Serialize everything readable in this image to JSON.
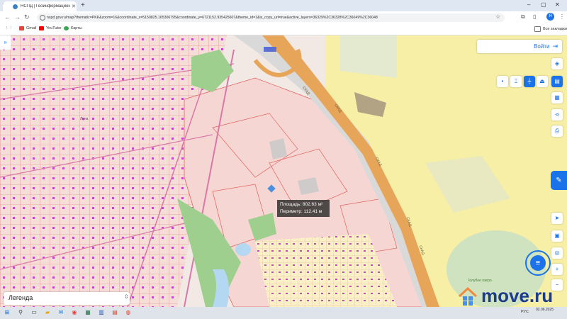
{
  "browser": {
    "tab_title": "НСПД | Геоинформационный",
    "url": "nspd.gov.ru/map?thematic=PKK&zoom=16&coordinate_x=5150825.165306795&coordinate_y=6721152.935425607&theme_id=1&is_copy_url=true&active_layers=36329%2C36328%2C36049%2C36048",
    "bookmarks": [
      {
        "label": "Gmail",
        "icon": "gmail-icon",
        "color": "#ea4335"
      },
      {
        "label": "YouTube",
        "icon": "youtube-icon",
        "color": "#ff0000"
      },
      {
        "label": "Карты",
        "icon": "maps-icon",
        "color": "#34a853"
      }
    ],
    "all_bookmarks": "Все закладки",
    "profile_initial": "Я"
  },
  "map": {
    "login_label": "Войти",
    "road_label_1": "СКАД",
    "road_label_2": "СКАД",
    "road_label_3": "СКАД",
    "road_label_4": "СКАД",
    "road_label_5": "СКАД",
    "area_label": "Голубое озеро",
    "place_label": "Луна",
    "measure": {
      "area": "Площадь: 802.63 м²",
      "perimeter": "Периметр: 112.41 м"
    },
    "legend_label": "Легенда",
    "colors": {
      "accent": "#1a73e8",
      "parcel_border": "#e0625f",
      "parcel_fill": "#f6d6d3",
      "road": "#e7a55a",
      "yellow_zone": "#f7efa6",
      "park": "#9ecf8e",
      "water": "#b4d7f2"
    }
  },
  "watermark": "move.ru",
  "taskbar": {
    "lang": "РУС",
    "time": "",
    "date": "02.06.2025"
  }
}
